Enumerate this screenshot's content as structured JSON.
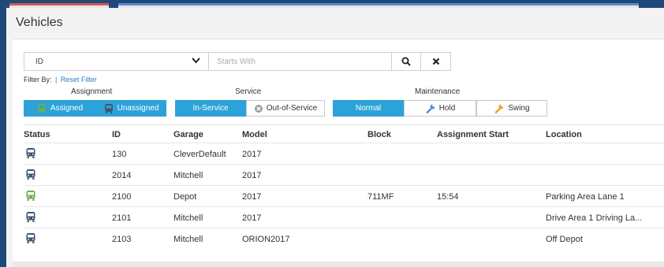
{
  "page": {
    "title": "Vehicles"
  },
  "search": {
    "field_value": "ID",
    "placeholder": "Starts With"
  },
  "filter": {
    "label": "Filter By:",
    "separator": "|",
    "reset_label": "Reset Filter",
    "groups": {
      "assignment": {
        "label": "Assignment",
        "options": [
          "Assigned",
          "Unassigned"
        ],
        "active": "Assigned"
      },
      "service": {
        "label": "Service",
        "options": [
          "In-Service",
          "Out-of-Service"
        ],
        "active": "In-Service"
      },
      "maintenance": {
        "label": "Maintenance",
        "options": [
          "Normal",
          "Hold",
          "Swing"
        ],
        "active": "Normal"
      }
    }
  },
  "table": {
    "columns": [
      "Status",
      "ID",
      "Garage",
      "Model",
      "Block",
      "Assignment Start",
      "Location"
    ],
    "rows": [
      {
        "status": "unassigned",
        "id": "130",
        "garage": "CleverDefault",
        "model": "2017",
        "block": "",
        "start": "",
        "location": ""
      },
      {
        "status": "unassigned",
        "id": "2014",
        "garage": "Mitchell",
        "model": "2017",
        "block": "",
        "start": "",
        "location": ""
      },
      {
        "status": "assigned",
        "id": "2100",
        "garage": "Depot",
        "model": "2017",
        "block": "711MF",
        "start": "15:54",
        "location": "Parking Area Lane 1"
      },
      {
        "status": "unassigned",
        "id": "2101",
        "garage": "Mitchell",
        "model": "2017",
        "block": "",
        "start": "",
        "location": "Drive Area 1 Driving La..."
      },
      {
        "status": "unassigned",
        "id": "2103",
        "garage": "Mitchell",
        "model": "ORION2017",
        "block": "",
        "start": "",
        "location": "Off Depot"
      }
    ]
  },
  "colors": {
    "accent": "#2da2d8",
    "link": "#2a7fc7",
    "bus_assigned": "#6ab04c",
    "bus_unassigned": "#3f5573",
    "frame": "#1d4a7a"
  },
  "icons": {
    "dropdown": "chevron-down-icon",
    "search": "search-icon",
    "clear": "close-icon",
    "bus": "bus-icon",
    "out_of_service": "out-of-service-icon",
    "wrench": "wrench-icon"
  }
}
